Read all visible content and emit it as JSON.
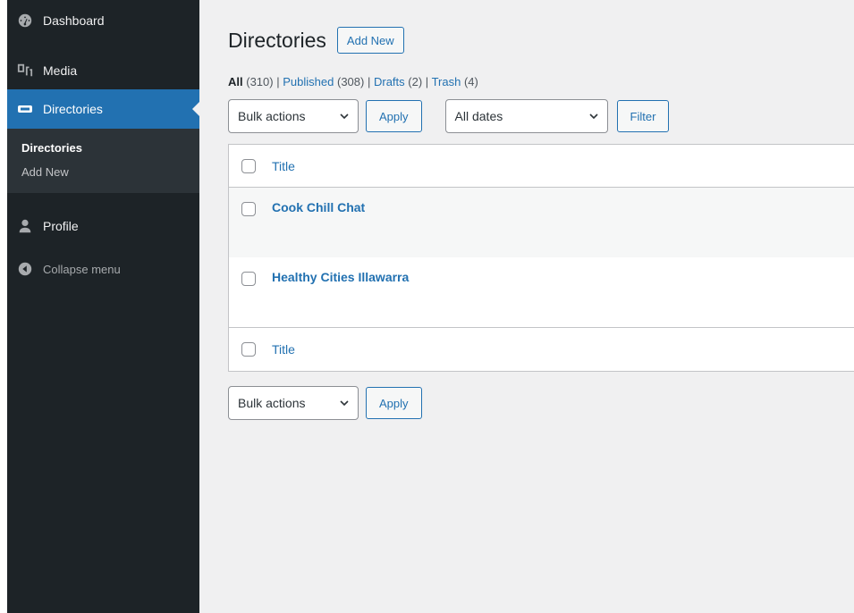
{
  "sidebar": {
    "items": [
      {
        "label": "Dashboard",
        "icon": "dashboard-icon"
      },
      {
        "label": "Media",
        "icon": "media-icon"
      },
      {
        "label": "Directories",
        "icon": "directories-icon"
      }
    ],
    "submenu": [
      {
        "label": "Directories"
      },
      {
        "label": "Add New"
      }
    ],
    "profile": {
      "label": "Profile",
      "icon": "profile-icon"
    },
    "collapse": {
      "label": "Collapse menu",
      "icon": "collapse-icon"
    }
  },
  "header": {
    "title": "Directories",
    "add_new_label": "Add New"
  },
  "filters": {
    "all_label": "All",
    "all_count": "(310)",
    "published_label": "Published",
    "published_count": "(308)",
    "drafts_label": "Drafts",
    "drafts_count": "(2)",
    "trash_label": "Trash",
    "trash_count": "(4)",
    "separator": "|"
  },
  "tablenav": {
    "bulk_actions": "Bulk actions",
    "apply_label": "Apply",
    "dates": "All dates",
    "filter_label": "Filter"
  },
  "table": {
    "column_title": "Title",
    "rows": [
      {
        "title": "Cook Chill Chat"
      },
      {
        "title": "Healthy Cities Illawarra"
      }
    ]
  },
  "colors": {
    "sidebar_bg": "#1d2327",
    "accent": "#2271b1",
    "page_bg": "#f0f0f1"
  }
}
